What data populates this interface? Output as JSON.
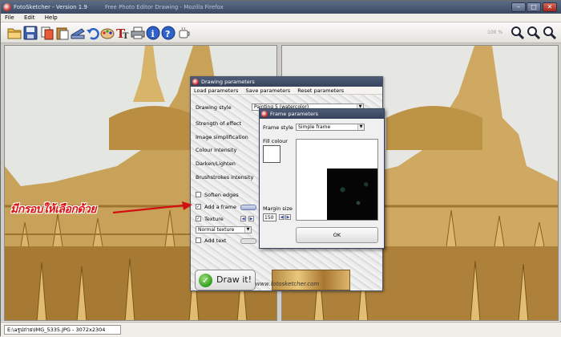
{
  "window": {
    "title": "FotoSketcher - Version 1.9",
    "title_extra": "Free Photo Editor Drawing - Mozilla Firefox",
    "minimize": "–",
    "maximize": "□",
    "close": "✕"
  },
  "menu": [
    "File",
    "Edit",
    "Help"
  ],
  "toolbar": {
    "icons": [
      "folder-open-icon",
      "save-icon",
      "copy-icon",
      "paste-icon",
      "scanner-icon",
      "undo-icon",
      "palette-icon",
      "text-icon",
      "print-icon",
      "info-icon",
      "help-icon",
      "coffee-icon"
    ],
    "zoom_level": "100 %",
    "zoom_icons": [
      "zoom-in-icon",
      "zoom-out-icon",
      "zoom-fit-icon"
    ]
  },
  "status": {
    "text": "E:\\aรูปถ่าย\\IMG_5335.JPG - 3072x2304"
  },
  "drawing_dialog": {
    "title": "Drawing parameters",
    "menu": [
      "Load parameters",
      "Save parameters",
      "Reset parameters"
    ],
    "drawing_style_label": "Drawing style",
    "drawing_style_value": "Painting 5 (watercolor)",
    "strength_label": "Strength of effect",
    "simplification_label": "Image simplification",
    "colour_intensity_label": "Colour intensity",
    "darken_label": "Darken/Lighten",
    "brushstrokes_label": "Brushstrokes intensity",
    "soften_edges_label": "Soften edges",
    "soften_edges_checked": false,
    "add_frame_label": "Add a frame",
    "add_frame_checked": true,
    "texture_label": "Texture",
    "texture_checked": true,
    "texture_value": "Normal texture",
    "add_text_label": "Add text",
    "add_text_checked": false,
    "draw_button": "Draw it!",
    "draw_check": "✓",
    "url": "www.fotosketcher.com"
  },
  "frame_dialog": {
    "title": "Frame parameters",
    "frame_style_label": "Frame style",
    "frame_style_value": "Simple frame",
    "fill_colour_label": "Fill colour",
    "margin_size_label": "Margin size",
    "margin_size_value": "150",
    "ok_button": "OK"
  },
  "annotation": {
    "text": "มีกรอบให้เลือกด้วย"
  },
  "colors": {
    "titlebar": "#3c4a63",
    "arrow": "#d11111",
    "sky": "#e4e6e2",
    "gold": "#c9a25a"
  }
}
